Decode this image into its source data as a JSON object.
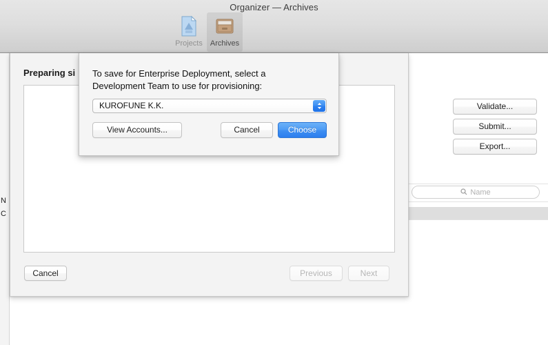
{
  "window": {
    "title": "Organizer — Archives",
    "toolbar": {
      "tabs": [
        {
          "label": "Projects",
          "icon": "project-document-icon",
          "selected": false
        },
        {
          "label": "Archives",
          "icon": "file-cabinet-icon",
          "selected": true
        }
      ]
    }
  },
  "sheet": {
    "title": "Preparing si",
    "cancel_label": "Cancel",
    "previous_label": "Previous",
    "next_label": "Next"
  },
  "dialog": {
    "message_line1": "To save for Enterprise Deployment, select a",
    "message_line2": "Development Team to use for provisioning:",
    "team_value": "KUROFUNE K.K.",
    "stepper_icon": "chevron-up-down-icon",
    "view_accounts_label": "View Accounts...",
    "cancel_label": "Cancel",
    "choose_label": "Choose",
    "choose_color": "#3f8ff2"
  },
  "right_panel": {
    "actions": [
      {
        "label": "Validate..."
      },
      {
        "label": "Submit..."
      },
      {
        "label": "Export..."
      }
    ],
    "search": {
      "placeholder": "Name",
      "value": "",
      "icon": "search-icon"
    }
  },
  "table": {
    "clipped_headers": [
      "N",
      "C"
    ]
  }
}
